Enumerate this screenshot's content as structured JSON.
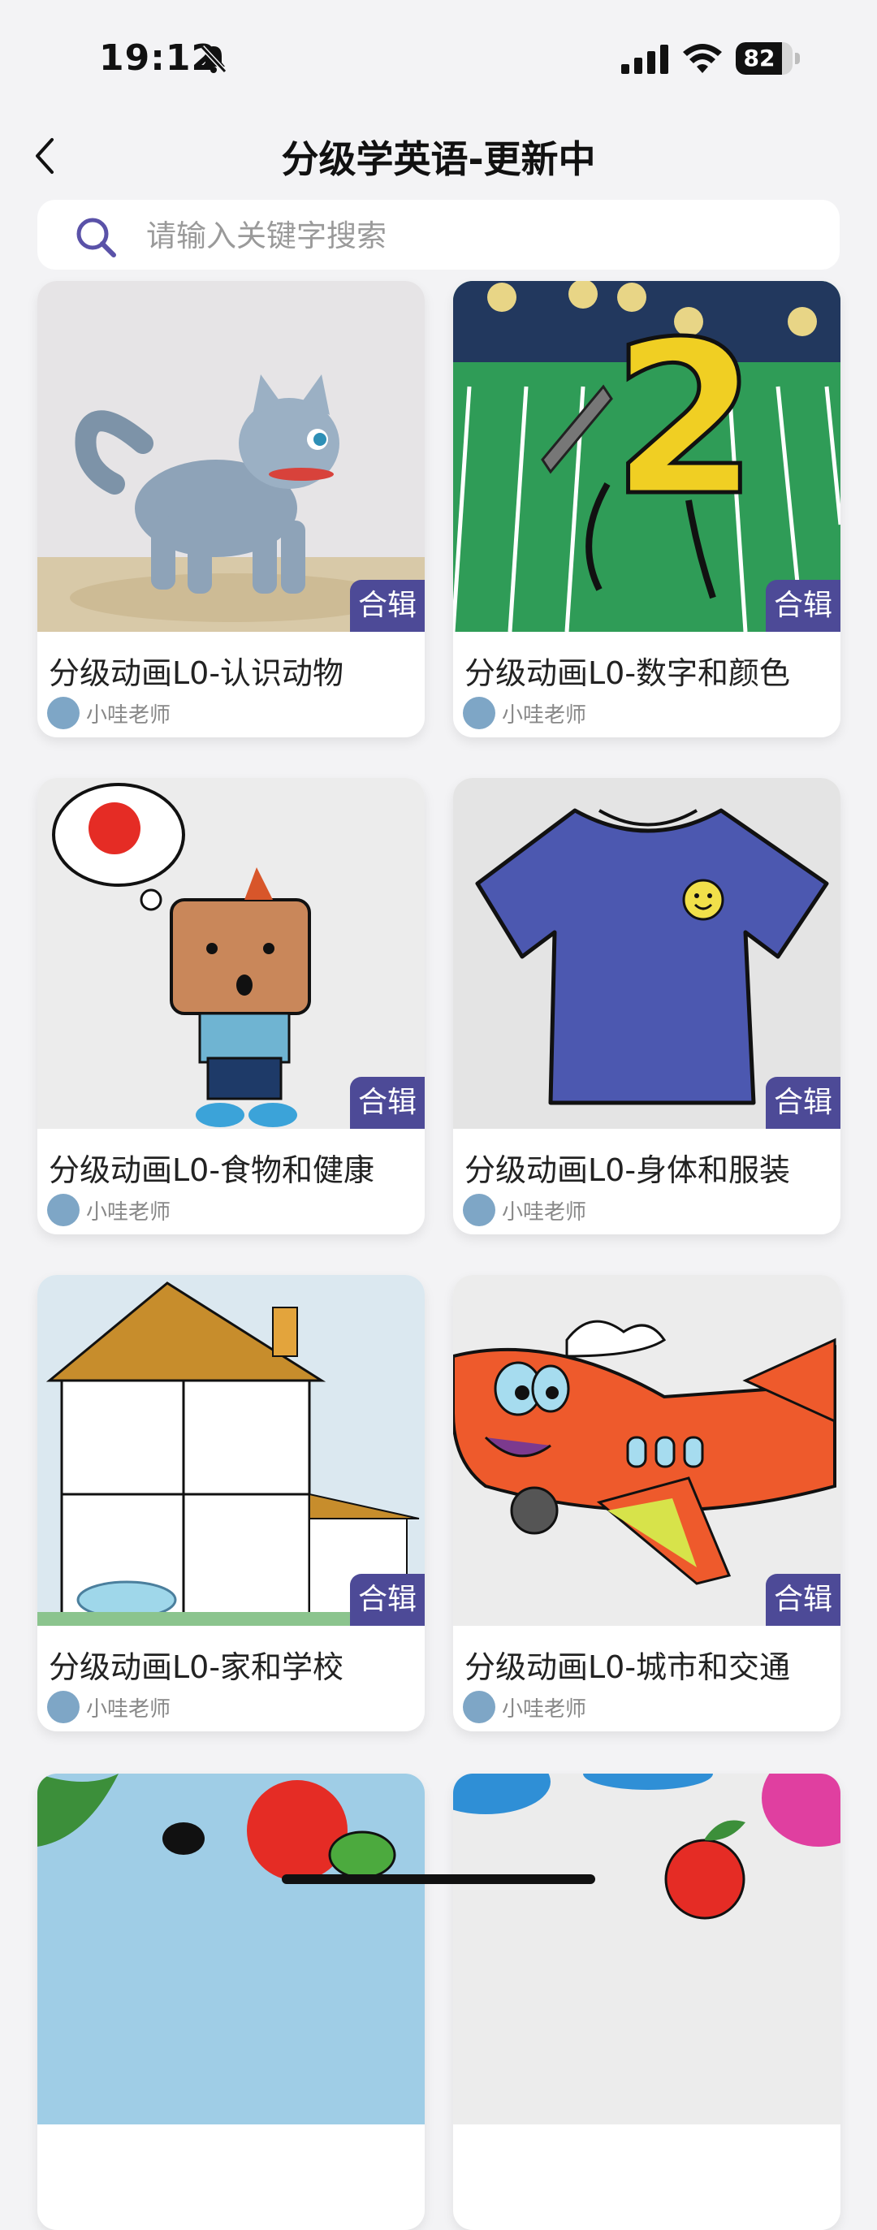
{
  "status_bar": {
    "time": "19:12",
    "battery": "82",
    "battery_level": 0.82
  },
  "header": {
    "title": "分级学英语-更新中"
  },
  "search": {
    "placeholder": "请输入关键字搜索"
  },
  "cards": [
    {
      "title": "分级动画L0-认识动物",
      "badge": "合辑",
      "author": "小哇老师"
    },
    {
      "title": "分级动画L0-数字和颜色",
      "badge": "合辑",
      "author": "小哇老师"
    },
    {
      "title": "分级动画L0-食物和健康",
      "badge": "合辑",
      "author": "小哇老师"
    },
    {
      "title": "分级动画L0-身体和服装",
      "badge": "合辑",
      "author": "小哇老师"
    },
    {
      "title": "分级动画L0-家和学校",
      "badge": "合辑",
      "author": "小哇老师"
    },
    {
      "title": "分级动画L0-城市和交通",
      "badge": "合辑",
      "author": "小哇老师"
    }
  ],
  "colors": {
    "badge": "#4d4a97",
    "search_icon": "#5a52a8",
    "background": "#f3f3f5"
  }
}
